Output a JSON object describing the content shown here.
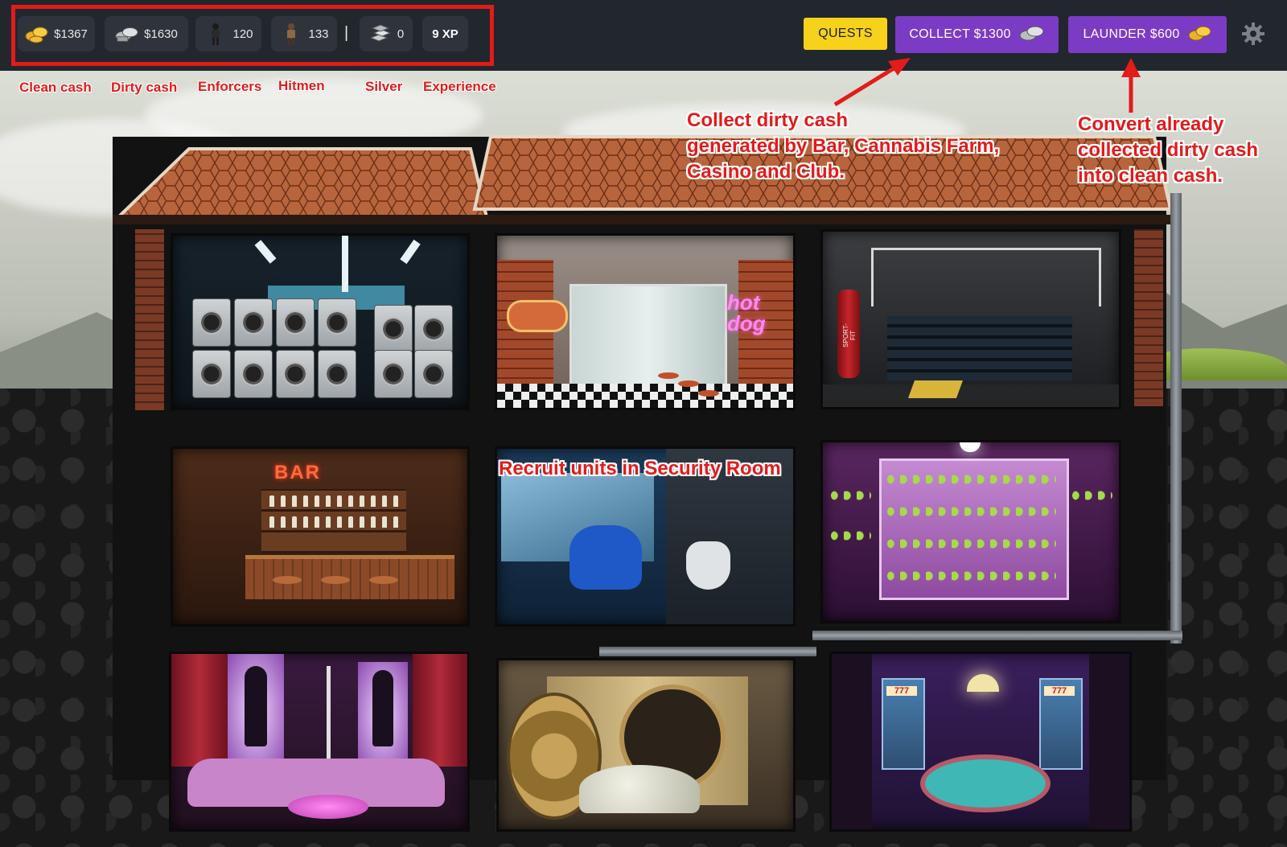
{
  "stats": {
    "clean_cash": "$1367",
    "dirty_cash": "$1630",
    "enforcers": "120",
    "hitmen": "133",
    "separator": "|",
    "silver": "0",
    "experience": "9 XP"
  },
  "stat_icons": {
    "clean_cash": "gold-coins-icon",
    "dirty_cash": "silver-coins-icon",
    "enforcers": "enforcer-figure-icon",
    "hitmen": "hitman-figure-icon",
    "silver": "silver-bars-icon"
  },
  "buttons": {
    "quests": "QUESTS",
    "collect": "COLLECT $1300",
    "launder": "LAUNDER $600"
  },
  "labels": {
    "clean_cash": "Clean cash",
    "dirty_cash": "Dirty cash",
    "enforcers": "Enforcers",
    "hitmen": "Hitmen",
    "silver": "Silver",
    "experience": "Experience"
  },
  "callouts": {
    "collect": [
      "Collect dirty cash",
      "generated by Bar, Cannabis Farm,",
      "Casino and Club."
    ],
    "launder": [
      "Convert already",
      "collected dirty cash",
      "into clean cash."
    ],
    "security": "Recruit units in Security Room"
  },
  "rooms": {
    "bar_sign": "BAR",
    "hotdog_sign": "hot dog",
    "sport_sign": "SPORT-FIT",
    "slot_left": "777",
    "slot_right": "777"
  },
  "colors": {
    "topbar": "#22262d",
    "pill": "#2f343c",
    "accent_purple": "#7c3bc4",
    "quests_yellow": "#f7d21b",
    "annotation_red": "#e21b1b"
  }
}
